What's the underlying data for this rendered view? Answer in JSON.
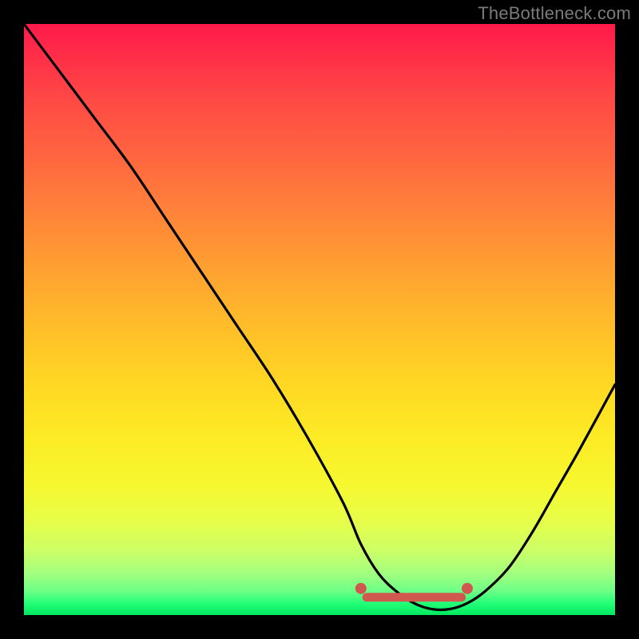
{
  "watermark": "TheBottleneck.com",
  "chart_data": {
    "type": "line",
    "title": "",
    "xlabel": "",
    "ylabel": "",
    "xlim": [
      0,
      100
    ],
    "ylim": [
      0,
      100
    ],
    "grid": false,
    "series": [
      {
        "name": "bottleneck-curve",
        "x": [
          0,
          6,
          12,
          18,
          24,
          30,
          36,
          42,
          48,
          54,
          57,
          60,
          63,
          66,
          69,
          72,
          75,
          78,
          82,
          86,
          90,
          94,
          100
        ],
        "y": [
          100,
          92,
          84,
          76,
          67,
          58,
          49,
          40,
          30,
          19,
          12,
          7,
          4,
          2,
          1,
          1,
          2,
          4,
          8,
          14,
          21,
          28,
          39
        ]
      }
    ],
    "markers": [
      {
        "name": "left-cap",
        "x": 57,
        "y": 4.5,
        "color": "#d1584f"
      },
      {
        "name": "right-cap",
        "x": 75,
        "y": 4.5,
        "color": "#d1584f"
      }
    ],
    "floor_band": {
      "x_start": 58,
      "x_end": 74,
      "y": 3,
      "color": "#d1584f"
    },
    "background": {
      "type": "vertical-gradient",
      "stops": [
        {
          "pos": 0.0,
          "color": "#ff1a4b"
        },
        {
          "pos": 0.5,
          "color": "#ffc527"
        },
        {
          "pos": 0.85,
          "color": "#e7fd48"
        },
        {
          "pos": 1.0,
          "color": "#00e85f"
        }
      ]
    }
  }
}
